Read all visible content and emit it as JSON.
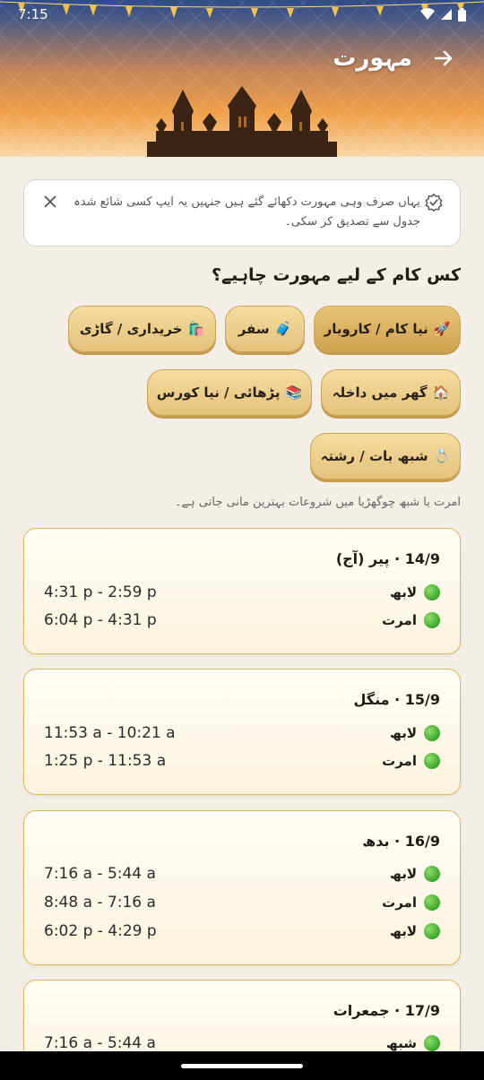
{
  "status": {
    "time": "7:15"
  },
  "header": {
    "title": "مہورت"
  },
  "note": {
    "text": "یہاں صرف وہی مہورت دکھائے گئے ہیں جنہیں یہ ایپ کسی شائع شدہ جدول سے تصدیق کر سکی۔"
  },
  "question": "کس کام کے لیے مہورت چاہیے؟",
  "chips": [
    {
      "emoji": "🚀",
      "label": "نیا کام / کاروبار",
      "selected": true
    },
    {
      "emoji": "🧳",
      "label": "سفر",
      "selected": false
    },
    {
      "emoji": "🛍️",
      "label": "خریداری / گاڑی",
      "selected": false
    },
    {
      "emoji": "🏠",
      "label": "گھر میں داخلہ",
      "selected": false
    },
    {
      "emoji": "📚",
      "label": "پڑھائی / نیا کورس",
      "selected": false
    },
    {
      "emoji": "💍",
      "label": "شبھ بات / رشتہ",
      "selected": false
    }
  ],
  "hint": "امرت یا شبھ چوگھڑیا میں شروعات بہترین مانی جاتی ہے۔",
  "cards": [
    {
      "title": "14/9 · پیر (آج)",
      "slots": [
        {
          "label": "لابھ",
          "time": "4:31 p - 2:59 p"
        },
        {
          "label": "امرت",
          "time": "6:04 p - 4:31 p"
        }
      ]
    },
    {
      "title": "15/9 · منگل",
      "slots": [
        {
          "label": "لابھ",
          "time": "11:53 a - 10:21 a"
        },
        {
          "label": "امرت",
          "time": "1:25 p - 11:53 a"
        }
      ]
    },
    {
      "title": "16/9 · بدھ",
      "slots": [
        {
          "label": "لابھ",
          "time": "7:16 a - 5:44 a"
        },
        {
          "label": "امرت",
          "time": "8:48 a - 7:16 a"
        },
        {
          "label": "لابھ",
          "time": "6:02 p - 4:29 p"
        }
      ]
    },
    {
      "title": "17/9 · جمعرات",
      "slots": [
        {
          "label": "شبھ",
          "time": "7:16 a - 5:44 a"
        }
      ]
    }
  ],
  "colors": {
    "accent": "#e4c27a",
    "card_border": "#d8b860",
    "dot": "#3aa52a",
    "background": "#f3efe6"
  }
}
